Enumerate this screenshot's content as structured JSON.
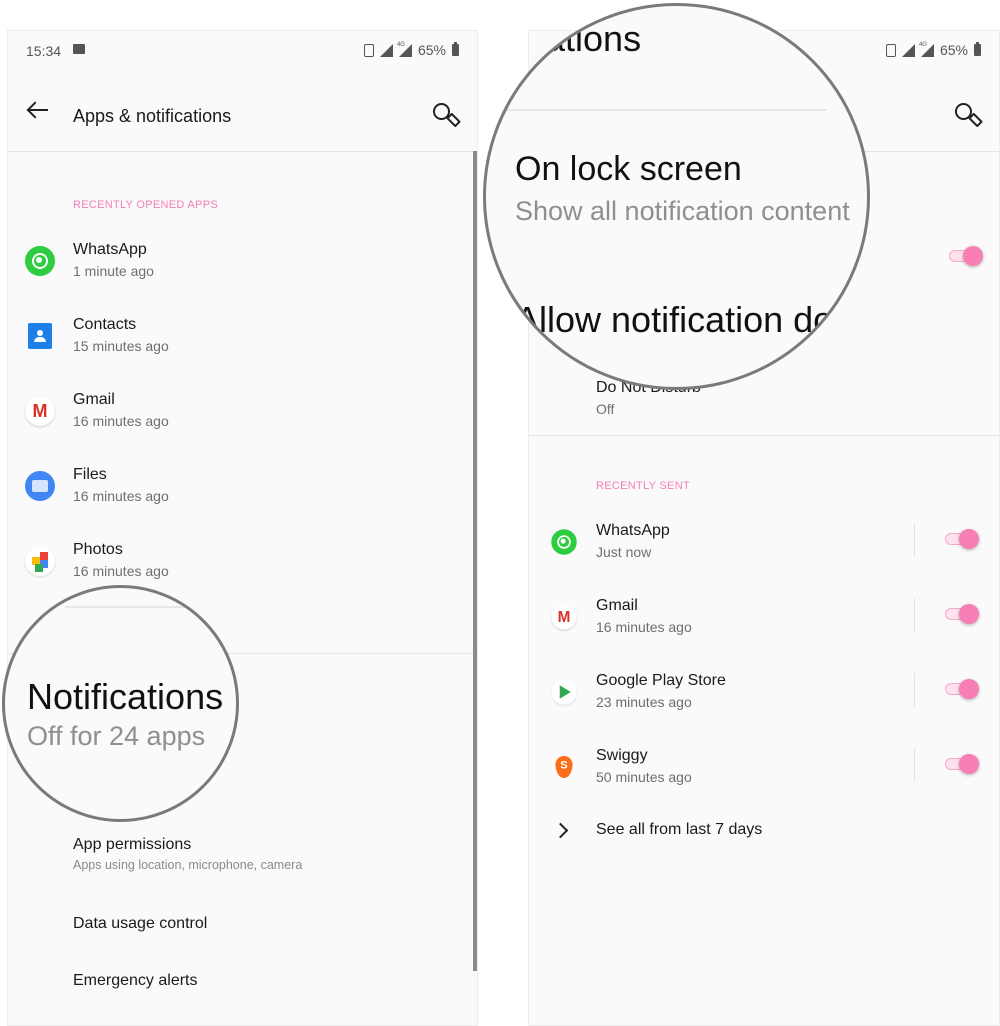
{
  "left_screen": {
    "status_bar": {
      "time": "15:34",
      "battery": "65%",
      "network": "4G",
      "icons": [
        "image-icon",
        "vibrate-icon",
        "signal-icon",
        "signal-4g-icon",
        "battery-icon"
      ]
    },
    "app_bar": {
      "title": "Apps & notifications",
      "back_icon": "back-arrow-icon",
      "search_icon": "search-icon"
    },
    "recent_section": {
      "header": "RECENTLY OPENED APPS",
      "apps": [
        {
          "name": "WhatsApp",
          "time": "1 minute ago",
          "icon": "whatsapp-icon"
        },
        {
          "name": "Contacts",
          "time": "15 minutes ago",
          "icon": "contacts-icon"
        },
        {
          "name": "Gmail",
          "time": "16 minutes ago",
          "icon": "gmail-icon"
        },
        {
          "name": "Files",
          "time": "16 minutes ago",
          "icon": "files-icon"
        },
        {
          "name": "Photos",
          "time": "16 minutes ago",
          "icon": "photos-icon"
        }
      ]
    },
    "magnified": {
      "title": "Notifications",
      "subtitle": "Off for 24 apps"
    },
    "settings": [
      {
        "title": "App permissions",
        "subtitle": "Apps using location, microphone, camera"
      },
      {
        "title": "Data usage control"
      },
      {
        "title": "Emergency alerts"
      }
    ]
  },
  "right_screen": {
    "status_bar": {
      "battery": "65%",
      "network": "4G"
    },
    "app_bar": {
      "title_fragment": "tifications",
      "search_icon": "search-icon"
    },
    "magnified": {
      "lock_screen_title": "On lock screen",
      "lock_screen_value": "Show all notification content",
      "allow_dots_title": "Allow notification do"
    },
    "dots_toggle_on": true,
    "do_not_disturb": {
      "title": "Do Not Disturb",
      "value": "Off"
    },
    "recent_section": {
      "header": "RECENTLY SENT",
      "apps": [
        {
          "name": "WhatsApp",
          "time": "Just now",
          "icon": "whatsapp-icon",
          "enabled": true
        },
        {
          "name": "Gmail",
          "time": "16 minutes ago",
          "icon": "gmail-icon",
          "enabled": true
        },
        {
          "name": "Google Play Store",
          "time": "23 minutes ago",
          "icon": "play-store-icon",
          "enabled": true
        },
        {
          "name": "Swiggy",
          "time": "50 minutes ago",
          "icon": "swiggy-icon",
          "enabled": true
        }
      ],
      "see_all": "See all from last 7 days"
    }
  },
  "colors": {
    "accent": "#f77fb6",
    "section_header": "#f27eb5",
    "background": "#fafafa"
  }
}
